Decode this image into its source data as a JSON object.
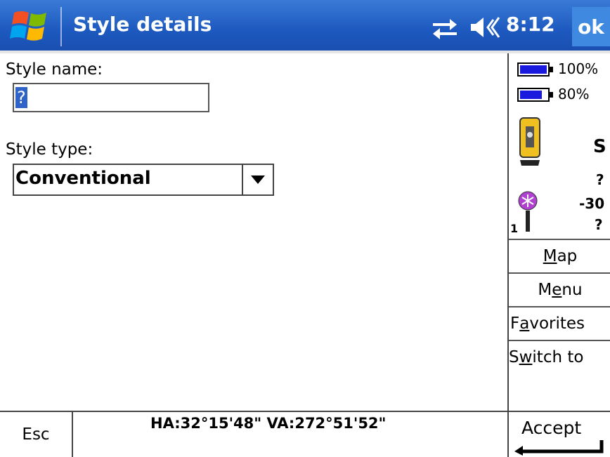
{
  "titlebar": {
    "title": "Style details",
    "clock": "8:12",
    "ok_label": "ok",
    "icons": [
      "windows-start-icon",
      "connectivity-icon",
      "volume-icon"
    ]
  },
  "form": {
    "style_name_label": "Style name:",
    "style_name_value": "?",
    "style_type_label": "Style type:",
    "style_type_value": "Conventional"
  },
  "status": {
    "battery1_pct": "100%",
    "battery2_pct": "80%",
    "instrument_letter": "S",
    "instrument_value": "?",
    "target_value": "-30",
    "target_q": "?",
    "target_number": "1"
  },
  "side_buttons": {
    "map": {
      "pre": "",
      "u": "M",
      "post": "ap"
    },
    "menu": {
      "pre": "M",
      "u": "e",
      "post": "nu"
    },
    "favorites": {
      "pre": "F",
      "u": "a",
      "post": "vorites"
    },
    "switch_to": {
      "pre": "S",
      "u": "w",
      "post": "itch to"
    }
  },
  "bottom": {
    "esc_label": "Esc",
    "angles": "HA:32°15'48\"  VA:272°51'52\"",
    "accept_label": "Accept"
  },
  "colors": {
    "titlebar": "#1d59bf",
    "ok_button": "#3f8ae0",
    "battery": "#1a1adf",
    "selection": "#2f63c8",
    "instrument": "#f0c020",
    "target": "#b040d0"
  }
}
